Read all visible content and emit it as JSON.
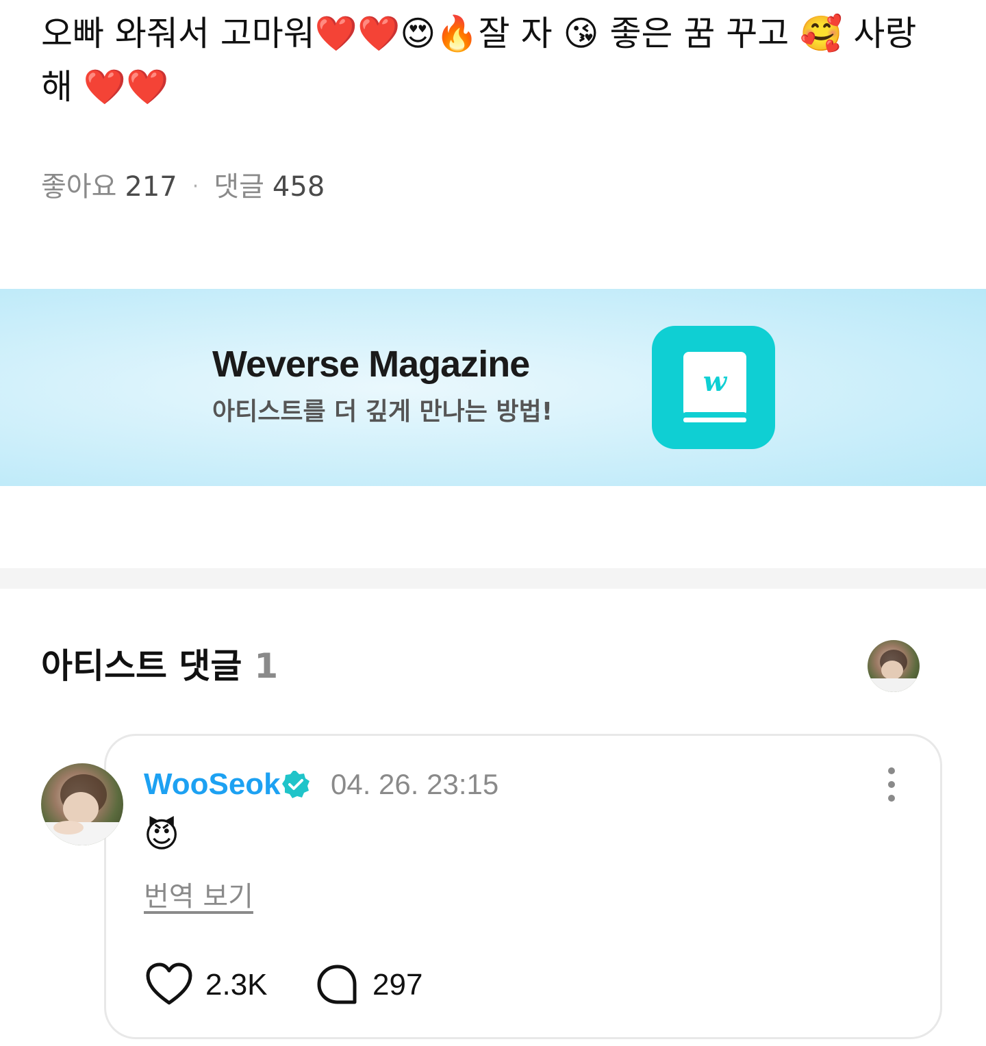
{
  "post": {
    "text": "오빠 와줘서 고마워❤️❤️😍🔥잘 자 😘 좋은 꿈 꾸고 🥰 사랑해 ❤️❤️",
    "likes_label": "좋아요",
    "likes_count": "217",
    "separator": "·",
    "comments_label": "댓글",
    "comments_count": "458"
  },
  "banner": {
    "title": "Weverse Magazine",
    "subtitle": "아티스트를 더 깊게 만나는 방법!",
    "icon": "weverse-magazine-app-icon",
    "icon_letter": "w",
    "accent_color": "#0fcfd3"
  },
  "artist_comments": {
    "title": "아티스트 댓글",
    "count": "1",
    "comment": {
      "author": "WooSeok",
      "verified_icon": "verified-badge-icon",
      "timestamp": "04. 26. 23:15",
      "body": "😈",
      "translate_label": "번역 보기",
      "likes": "2.3K",
      "replies": "297",
      "author_color": "#1da1f2"
    }
  }
}
